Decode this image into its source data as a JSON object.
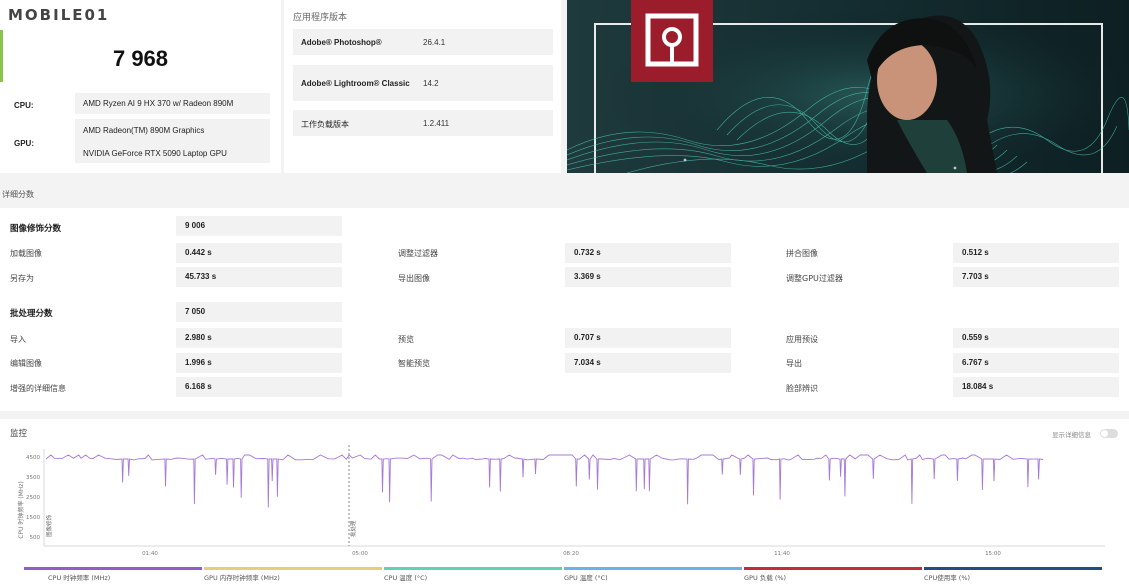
{
  "brand": {
    "logo_text": "MOBILE01"
  },
  "summary": {
    "score": "7 968",
    "cpu_label": "CPU:",
    "cpu_value": "AMD Ryzen AI 9 HX 370 w/ Radeon 890M",
    "gpu_label": "GPU:",
    "gpu_values": [
      "AMD Radeon(TM) 890M Graphics",
      "NVIDIA GeForce RTX 5090 Laptop GPU"
    ]
  },
  "versions": {
    "title": "应用程序版本",
    "rows": [
      {
        "name": "Adobe® Photoshop®",
        "value": "26.4.1"
      },
      {
        "name": "Adobe® Lightroom® Classic",
        "value": "14.2"
      },
      {
        "name": "工作负载版本",
        "value": "1.2.411"
      }
    ]
  },
  "details": {
    "title": "详细分数",
    "image_section": {
      "label": "图像修饰分数",
      "score": "9 006",
      "items": [
        {
          "label": "加载图像",
          "value": "0.442 s"
        },
        {
          "label": "调整过滤器",
          "value": "0.732 s"
        },
        {
          "label": "拼合图像",
          "value": "0.512 s"
        },
        {
          "label": "另存为",
          "value": "45.733 s"
        },
        {
          "label": "导出图像",
          "value": "3.369 s"
        },
        {
          "label": "调整GPU过滤器",
          "value": "7.703 s"
        }
      ]
    },
    "batch_section": {
      "label": "批处理分数",
      "score": "7 050",
      "items": [
        {
          "label": "导入",
          "value": "2.980 s"
        },
        {
          "label": "预览",
          "value": "0.707 s"
        },
        {
          "label": "应用预设",
          "value": "0.559 s"
        },
        {
          "label": "编辑图像",
          "value": "1.996 s"
        },
        {
          "label": "智能预览",
          "value": "7.034 s"
        },
        {
          "label": "导出",
          "value": "6.767 s"
        },
        {
          "label": "增强的详细信息",
          "value": "6.168 s"
        },
        {
          "label": "脸部辨识",
          "value": "18.084 s"
        }
      ]
    }
  },
  "monitor": {
    "title": "监控",
    "toggle_label": "显示详细信息",
    "y_axis_label": "CPU 时钟频率 (MHz)",
    "y_ticks": [
      "4500",
      "3500",
      "2500",
      "1500",
      "500"
    ],
    "x_ticks": [
      "01:40",
      "05:00",
      "08:20",
      "11:40",
      "15:00"
    ],
    "markers": [
      "图像修饰",
      "批处理"
    ],
    "legend": [
      {
        "label": "CPU 时钟频率 (MHz)",
        "color": "#8e5fc9"
      },
      {
        "label": "GPU 内存时钟频率 (MHz)",
        "color": "#e6cf7a"
      },
      {
        "label": "CPU 温度 (°C)",
        "color": "#5ed3b4"
      },
      {
        "label": "GPU 温度 (°C)",
        "color": "#6ab2e8"
      },
      {
        "label": "GPU 负载 (%)",
        "color": "#c62b3a"
      },
      {
        "label": "CPU使用率 (%)",
        "color": "#1f4f86"
      }
    ],
    "line_color": "#a678d8"
  }
}
